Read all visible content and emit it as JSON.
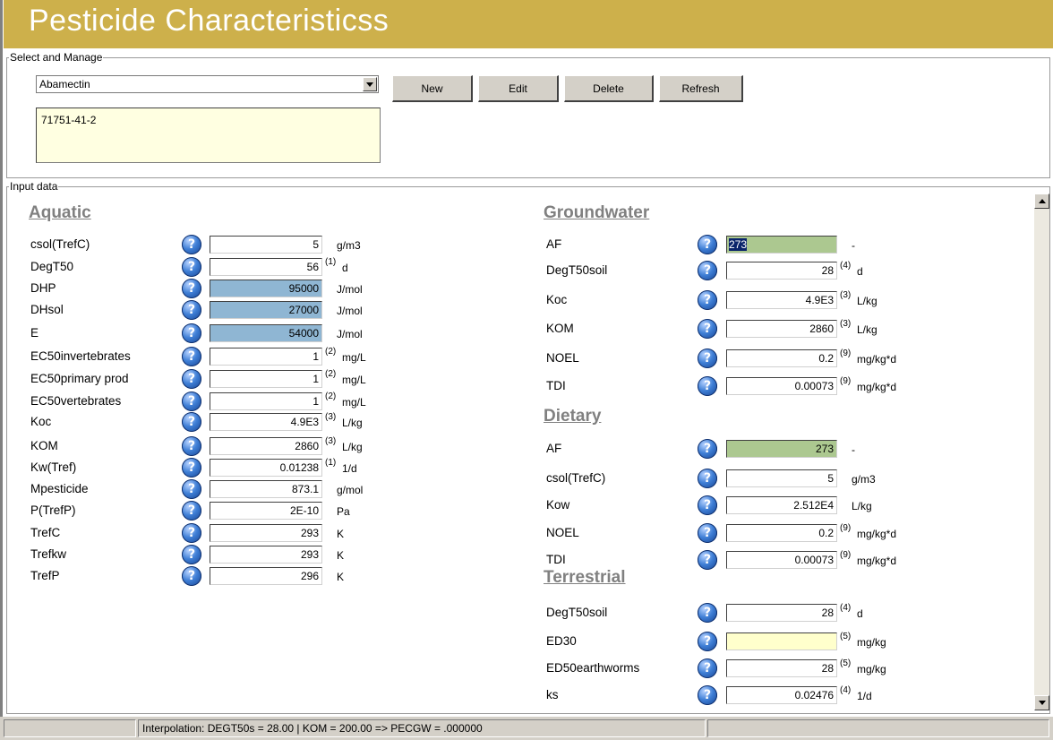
{
  "title": "Pesticide Characteristicss",
  "manage": {
    "legend": "Select and Manage",
    "selected": "Abamectin",
    "cas": "71751-41-2",
    "buttons": {
      "new": "New",
      "edit": "Edit",
      "delete": "Delete",
      "refresh": "Refresh"
    }
  },
  "input": {
    "legend": "Input data",
    "aquatic": {
      "heading": "Aquatic",
      "rows": [
        {
          "label": "csol(TrefC)",
          "value": "5",
          "ref": "",
          "unit": "g/m3"
        },
        {
          "label": "DegT50",
          "value": "56",
          "ref": "(1)",
          "unit": "d"
        },
        {
          "label": "DHP",
          "value": "95000",
          "ref": "",
          "unit": "J/mol"
        },
        {
          "label": "DHsol",
          "value": "27000",
          "ref": "",
          "unit": "J/mol"
        },
        {
          "label": "E",
          "value": "54000",
          "ref": "",
          "unit": "J/mol"
        },
        {
          "label": "EC50invertebrates",
          "value": "1",
          "ref": "(2)",
          "unit": "mg/L"
        },
        {
          "label": "EC50primary prod",
          "value": "1",
          "ref": "(2)",
          "unit": "mg/L"
        },
        {
          "label": "EC50vertebrates",
          "value": "1",
          "ref": "(2)",
          "unit": "mg/L"
        },
        {
          "label": "Koc",
          "value": "4.9E3",
          "ref": "(3)",
          "unit": "L/kg"
        },
        {
          "label": "KOM",
          "value": "2860",
          "ref": "(3)",
          "unit": "L/kg"
        },
        {
          "label": "Kw(Tref)",
          "value": "0.01238",
          "ref": "(1)",
          "unit": "1/d"
        },
        {
          "label": "Mpesticide",
          "value": "873.1",
          "ref": "",
          "unit": "g/mol"
        },
        {
          "label": "P(TrefP)",
          "value": "2E-10",
          "ref": "",
          "unit": "Pa"
        },
        {
          "label": "TrefC",
          "value": "293",
          "ref": "",
          "unit": "K"
        },
        {
          "label": "Trefkw",
          "value": "293",
          "ref": "",
          "unit": "K"
        },
        {
          "label": "TrefP",
          "value": "296",
          "ref": "",
          "unit": "K"
        }
      ]
    },
    "groundwater": {
      "heading": "Groundwater",
      "rows": [
        {
          "label": "AF",
          "value": "273",
          "ref": "",
          "unit": "-"
        },
        {
          "label": "DegT50soil",
          "value": "28",
          "ref": "(4)",
          "unit": "d"
        },
        {
          "label": "Koc",
          "value": "4.9E3",
          "ref": "(3)",
          "unit": "L/kg"
        },
        {
          "label": "KOM",
          "value": "2860",
          "ref": "(3)",
          "unit": "L/kg"
        },
        {
          "label": "NOEL",
          "value": "0.2",
          "ref": "(9)",
          "unit": "mg/kg*d"
        },
        {
          "label": "TDI",
          "value": "0.00073",
          "ref": "(9)",
          "unit": "mg/kg*d"
        }
      ]
    },
    "dietary": {
      "heading": "Dietary",
      "rows": [
        {
          "label": "AF",
          "value": "273",
          "ref": "",
          "unit": "-"
        },
        {
          "label": "csol(TrefC)",
          "value": "5",
          "ref": "",
          "unit": "g/m3"
        },
        {
          "label": "Kow",
          "value": "2.512E4",
          "ref": "",
          "unit": "L/kg"
        },
        {
          "label": "NOEL",
          "value": "0.2",
          "ref": "(9)",
          "unit": "mg/kg*d"
        },
        {
          "label": "TDI",
          "value": "0.00073",
          "ref": "(9)",
          "unit": "mg/kg*d"
        }
      ]
    },
    "terrestrial": {
      "heading": "Terrestrial",
      "rows": [
        {
          "label": "DegT50soil",
          "value": "28",
          "ref": "(4)",
          "unit": "d"
        },
        {
          "label": "ED30",
          "value": "",
          "ref": "(5)",
          "unit": "mg/kg"
        },
        {
          "label": "ED50earthworms",
          "value": "28",
          "ref": "(5)",
          "unit": "mg/kg"
        },
        {
          "label": "ks",
          "value": "0.02476",
          "ref": "(4)",
          "unit": "1/d"
        }
      ]
    }
  },
  "status": "Interpolation: DEGT50s = 28.00 | KOM = 200.00 => PECGW = .000000"
}
